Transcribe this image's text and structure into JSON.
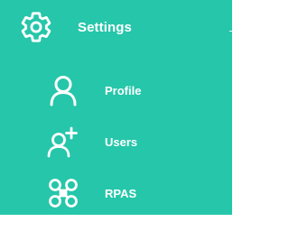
{
  "menu": {
    "header": {
      "label": "Settings",
      "icon": "gear-icon"
    },
    "items": [
      {
        "label": "Profile",
        "icon": "person-icon"
      },
      {
        "label": "Users",
        "icon": "add-user-icon"
      },
      {
        "label": "RPAS",
        "icon": "drone-icon"
      }
    ]
  },
  "colors": {
    "background": "#26c6aa",
    "text": "#ffffff"
  }
}
